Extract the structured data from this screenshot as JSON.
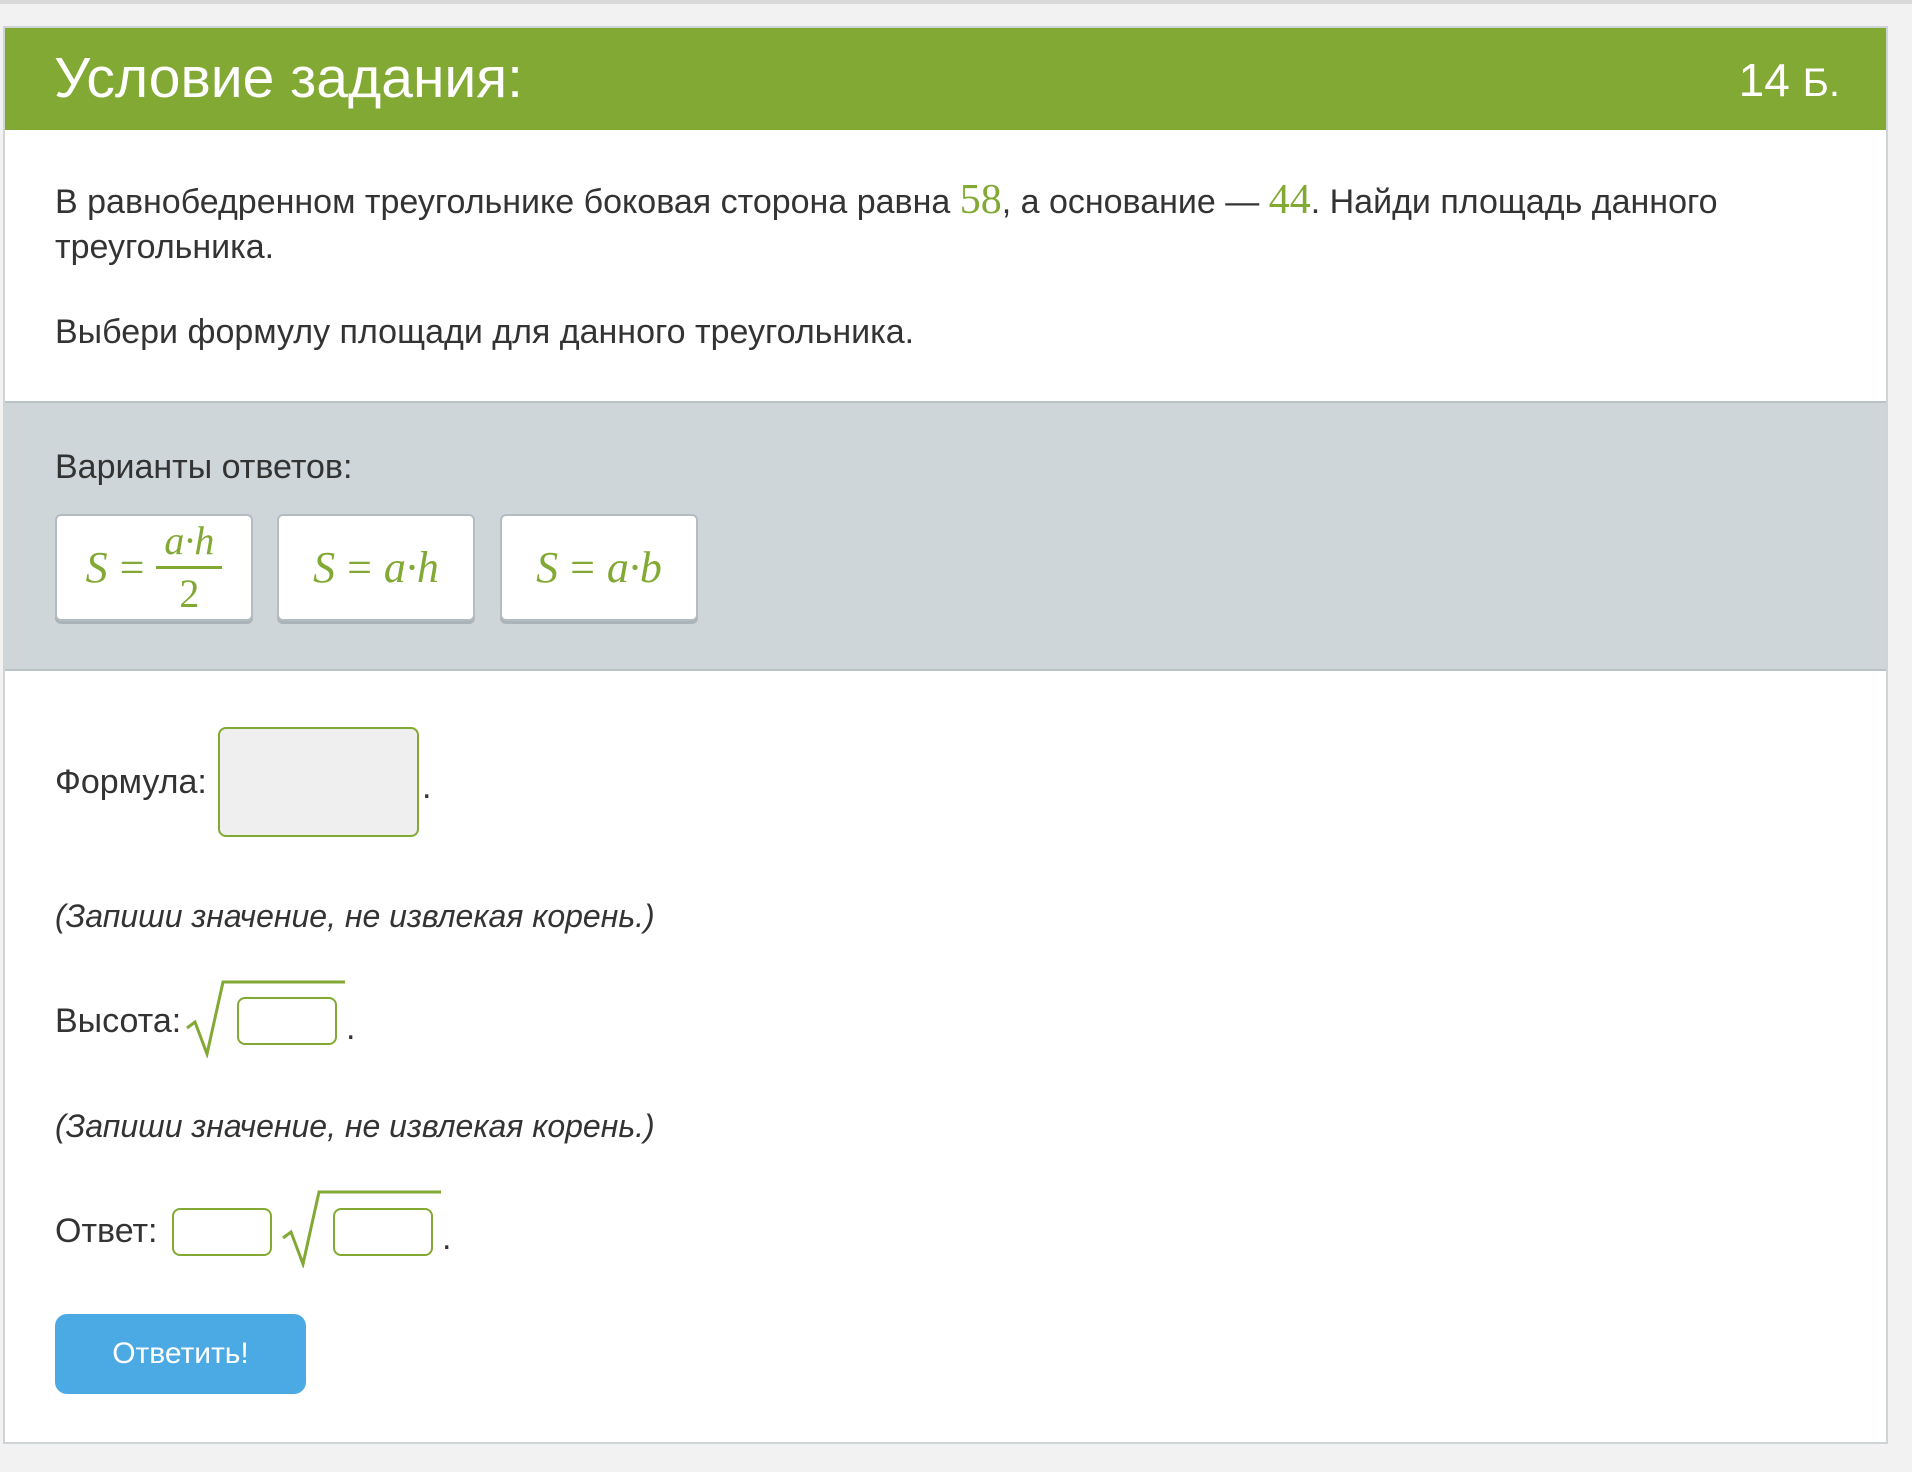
{
  "header": {
    "title": "Условие задания:",
    "points_value": "14",
    "points_unit": "Б."
  },
  "problem": {
    "text_part1": "В равнобедренном треугольнике боковая сторона равна ",
    "lateral_side": "58",
    "text_part2": ", а основание — ",
    "base": "44",
    "text_part3": ". Найди площадь данного треугольника.",
    "instruction": "Выбери формулу площади для данного треугольника."
  },
  "options": {
    "label": "Варианты ответов:",
    "items": [
      {
        "lhs": "S",
        "eq": "=",
        "numerator": "a·h",
        "denominator": "2"
      },
      {
        "lhs": "S",
        "eq": "=",
        "rhs": "a·h"
      },
      {
        "lhs": "S",
        "eq": "=",
        "rhs": "a·b"
      }
    ]
  },
  "answer_form": {
    "formula_label": "Формула:",
    "hint": "(Запиши значение, не извлекая корень.)",
    "height_label": "Высота:",
    "answer_label": "Ответ:",
    "terminator": ".",
    "height_value": "",
    "answer_coefficient_value": "",
    "answer_radicand_value": ""
  },
  "submit_label": "Ответить!",
  "colors": {
    "accent_green": "#82a934",
    "button_blue": "#4ba9e4",
    "options_panel_bg": "#ced6d9"
  }
}
